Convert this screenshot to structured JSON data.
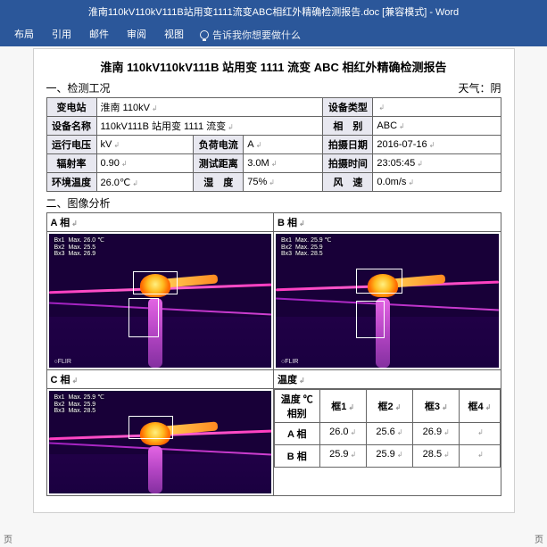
{
  "titlebar": "淮南110kV110kV111B站用变1111流变ABC相红外精确检测报告.doc [兼容模式] - Word",
  "ribbon": {
    "tabs": [
      "布局",
      "引用",
      "邮件",
      "审阅",
      "视图"
    ],
    "tellme_placeholder": "告诉我你想要做什么"
  },
  "doc": {
    "title": "淮南 110kV110kV111B 站用变 1111 流变 ABC 相红外精确检测报告",
    "sec1": "一、检测工况",
    "weather_label": "天气：阴",
    "info": {
      "station_h": "变电站",
      "station": "淮南 110kV",
      "devtype_h": "设备类型",
      "devtype": "",
      "devname_h": "设备名称",
      "devname": "110kV111B 站用变 1111 流变",
      "phase_h": "相　别",
      "phase": "ABC",
      "volt_h": "运行电压",
      "volt": "kV",
      "current_h": "负荷电流",
      "current": "A",
      "date_h": "拍摄日期",
      "date": "2016-07-16",
      "emiss_h": "辐射率",
      "emiss": "0.90",
      "dist_h": "测试距离",
      "dist": "3.0M",
      "time_h": "拍摄时间",
      "time": "23:05:45",
      "env_h": "环境温度",
      "env": "26.0℃",
      "hum_h": "湿　度",
      "hum": "75%",
      "wind_h": "风　速",
      "wind": "0.0m/s"
    },
    "sec2": "二、图像分析",
    "img_labels": {
      "a": "A 相",
      "b": "B 相",
      "c": "C 相",
      "temp": "温度"
    },
    "readbox": {
      "a": "Bx1  Max. 26.0 ℃\nBx2  Max. 25.5\nBx3  Max. 26.9",
      "b": "Bx1  Max. 25.9 ℃\nBx2  Max. 25.9\nBx3  Max. 28.5",
      "c": "Bx1  Max. 25.9 ℃\nBx2  Max. 25.9\nBx3  Max. 28.5"
    },
    "flir": "○FLIR",
    "temp_table": {
      "head": [
        "温度 ℃\n相别",
        "框1",
        "框2",
        "框3",
        "框4"
      ],
      "rows": [
        {
          "phase": "A 相",
          "v": [
            "26.0",
            "25.6",
            "26.9",
            ""
          ]
        },
        {
          "phase": "B 相",
          "v": [
            "25.9",
            "25.9",
            "28.5",
            ""
          ]
        }
      ]
    }
  },
  "status": {
    "left": "页",
    "right": "页"
  }
}
